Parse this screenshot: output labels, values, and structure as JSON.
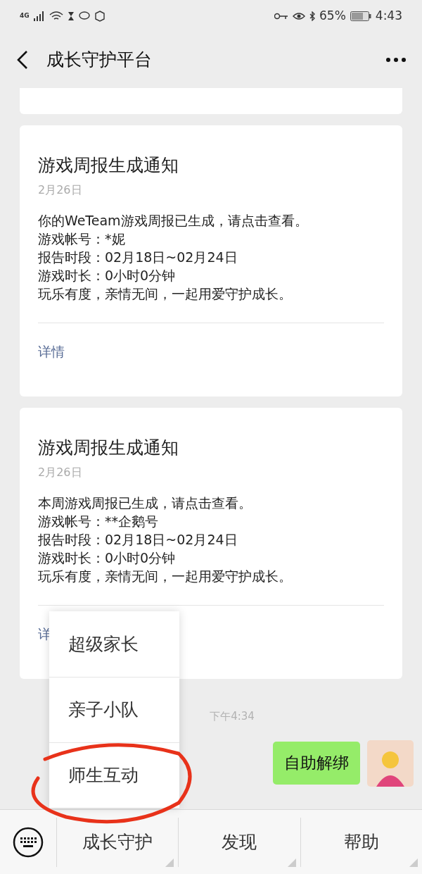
{
  "status_bar": {
    "network": "4G",
    "battery": "65%",
    "time": "4:43"
  },
  "nav": {
    "title": "成长守护平台"
  },
  "cards": [
    {
      "title": "游戏周报生成通知",
      "date": "2月26日",
      "lines": [
        "你的WeTeam游戏周报已生成，请点击查看。",
        "游戏帐号：*妮",
        "报告时段：02月18日~02月24日",
        "游戏时长：0小时0分钟",
        "玩乐有度，亲情无间，一起用爱守护成长。"
      ],
      "link": "详情"
    },
    {
      "title": "游戏周报生成通知",
      "date": "2月26日",
      "lines": [
        "本周游戏周报已生成，请点击查看。",
        "游戏帐号：**企鹅号",
        "报告时段：02月18日~02月24日",
        "游戏时长：0小时0分钟",
        "玩乐有度，亲情无间，一起用爱守护成长。"
      ],
      "link": "详"
    }
  ],
  "timestamp": "下午4:34",
  "message": {
    "text": "自助解绑"
  },
  "popup_menu": [
    {
      "label": "超级家长",
      "circled": false
    },
    {
      "label": "亲子小队",
      "circled": false
    },
    {
      "label": "师生互动",
      "circled": true
    }
  ],
  "bottom_menu": [
    {
      "label": "成长守护"
    },
    {
      "label": "发现"
    },
    {
      "label": "帮助"
    }
  ]
}
